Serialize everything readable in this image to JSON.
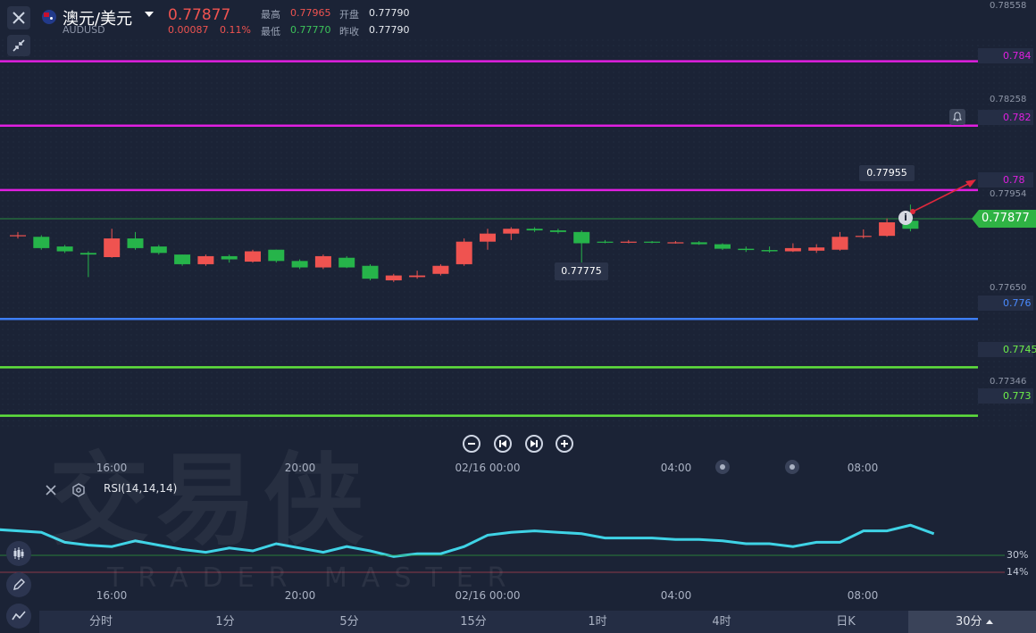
{
  "header": {
    "symbol_name": "澳元/美元",
    "symbol_code": "AUDUSD",
    "price": "0.77877",
    "change": "0.00087",
    "change_pct": "0.11%",
    "high_label": "最高",
    "high_value": "0.77965",
    "low_label": "最低",
    "low_value": "0.77770",
    "open_label": "开盘",
    "open_value": "0.77790",
    "prev_close_label": "昨收",
    "prev_close_value": "0.77790"
  },
  "price_axis": {
    "range": [
      0.7726,
      0.7859
    ],
    "faded_labels": [
      "0.78558",
      "0.78258",
      "0.77954",
      "0.77650",
      "0.77346"
    ],
    "current_price_tag": "0.77877"
  },
  "levels": [
    {
      "label": "0.784",
      "price": 0.784,
      "color": "#e01fe0"
    },
    {
      "label": "0.782",
      "price": 0.782,
      "color": "#e01fe0"
    },
    {
      "label": "0.78",
      "price": 0.78,
      "color": "#e01fe0"
    },
    {
      "label": "0.776",
      "price": 0.776,
      "color": "#3d7ef5"
    },
    {
      "label": "0.7745",
      "price": 0.7745,
      "color": "#5fe23c"
    },
    {
      "label": "0.773",
      "price": 0.773,
      "color": "#5fe23c"
    }
  ],
  "callouts": {
    "high_marker": "0.77955",
    "low_marker": "0.77775"
  },
  "time_axis": [
    "16:00",
    "20:00",
    "02/16 00:00",
    "04:00",
    "08:00"
  ],
  "indicator": {
    "name": "RSI(14,14,14)",
    "level_30": "30%",
    "level_14": "14%"
  },
  "watermark": {
    "main": "交易侠",
    "sub": "TRADER MASTER"
  },
  "timeframes": [
    "分时",
    "1分",
    "5分",
    "15分",
    "1时",
    "4时",
    "日K",
    "30分"
  ],
  "active_timeframe": "30分",
  "colors": {
    "up": "#ef5350",
    "down": "#26b44a",
    "current_price": "#2fb344",
    "rsi_line": "#3fd3e6"
  },
  "chart_data": {
    "type": "candlestick",
    "title": "AUDUSD 30分",
    "ylim": [
      0.7726,
      0.7859
    ],
    "candles": [
      {
        "o": 0.7786,
        "c": 0.7786,
        "h": 0.7787,
        "l": 0.7785
      },
      {
        "o": 0.77855,
        "c": 0.7782,
        "h": 0.7786,
        "l": 0.77815
      },
      {
        "o": 0.77825,
        "c": 0.7781,
        "h": 0.7783,
        "l": 0.77805
      },
      {
        "o": 0.77805,
        "c": 0.778,
        "h": 0.7781,
        "l": 0.7773
      },
      {
        "o": 0.77792,
        "c": 0.7785,
        "h": 0.7788,
        "l": 0.7779
      },
      {
        "o": 0.7785,
        "c": 0.7782,
        "h": 0.7787,
        "l": 0.77815
      },
      {
        "o": 0.77825,
        "c": 0.77805,
        "h": 0.7783,
        "l": 0.778
      },
      {
        "o": 0.778,
        "c": 0.7777,
        "h": 0.778,
        "l": 0.77765
      },
      {
        "o": 0.7777,
        "c": 0.77795,
        "h": 0.778,
        "l": 0.77765
      },
      {
        "o": 0.77795,
        "c": 0.77785,
        "h": 0.778,
        "l": 0.77775
      },
      {
        "o": 0.77778,
        "c": 0.7781,
        "h": 0.77815,
        "l": 0.77775
      },
      {
        "o": 0.77815,
        "c": 0.7778,
        "h": 0.77815,
        "l": 0.77775
      },
      {
        "o": 0.7778,
        "c": 0.7776,
        "h": 0.77785,
        "l": 0.77755
      },
      {
        "o": 0.7776,
        "c": 0.77795,
        "h": 0.778,
        "l": 0.77755
      },
      {
        "o": 0.7779,
        "c": 0.7776,
        "h": 0.77795,
        "l": 0.77758
      },
      {
        "o": 0.77765,
        "c": 0.77725,
        "h": 0.7777,
        "l": 0.7772
      },
      {
        "o": 0.7772,
        "c": 0.77735,
        "h": 0.7774,
        "l": 0.77715
      },
      {
        "o": 0.7773,
        "c": 0.77735,
        "h": 0.7775,
        "l": 0.77725
      },
      {
        "o": 0.7774,
        "c": 0.77765,
        "h": 0.7777,
        "l": 0.77735
      },
      {
        "o": 0.7777,
        "c": 0.7784,
        "h": 0.7785,
        "l": 0.77765
      },
      {
        "o": 0.7784,
        "c": 0.77865,
        "h": 0.7788,
        "l": 0.77815
      },
      {
        "o": 0.77865,
        "c": 0.7788,
        "h": 0.77885,
        "l": 0.77845
      },
      {
        "o": 0.7788,
        "c": 0.77875,
        "h": 0.77885,
        "l": 0.7787
      },
      {
        "o": 0.77875,
        "c": 0.7787,
        "h": 0.7788,
        "l": 0.77865
      },
      {
        "o": 0.7787,
        "c": 0.77835,
        "h": 0.77875,
        "l": 0.77775
      },
      {
        "o": 0.7784,
        "c": 0.77838,
        "h": 0.77845,
        "l": 0.77835
      },
      {
        "o": 0.77838,
        "c": 0.7784,
        "h": 0.77845,
        "l": 0.77835
      },
      {
        "o": 0.7784,
        "c": 0.77837,
        "h": 0.77842,
        "l": 0.77835
      },
      {
        "o": 0.77837,
        "c": 0.77838,
        "h": 0.77842,
        "l": 0.77834
      },
      {
        "o": 0.77838,
        "c": 0.77832,
        "h": 0.77842,
        "l": 0.7783
      },
      {
        "o": 0.77832,
        "c": 0.77818,
        "h": 0.77835,
        "l": 0.77814
      },
      {
        "o": 0.77818,
        "c": 0.77814,
        "h": 0.77825,
        "l": 0.77808
      },
      {
        "o": 0.77814,
        "c": 0.7781,
        "h": 0.77825,
        "l": 0.77806
      },
      {
        "o": 0.7781,
        "c": 0.7782,
        "h": 0.77835,
        "l": 0.77808
      },
      {
        "o": 0.77812,
        "c": 0.77822,
        "h": 0.77832,
        "l": 0.77805
      },
      {
        "o": 0.77815,
        "c": 0.77855,
        "h": 0.7787,
        "l": 0.77812
      },
      {
        "o": 0.77855,
        "c": 0.77858,
        "h": 0.77878,
        "l": 0.7785
      },
      {
        "o": 0.77858,
        "c": 0.779,
        "h": 0.77912,
        "l": 0.77855
      },
      {
        "o": 0.77905,
        "c": 0.7788,
        "h": 0.77955,
        "l": 0.77872
      }
    ],
    "rsi": [
      45,
      43,
      36,
      34,
      33,
      37,
      34,
      31,
      29,
      32,
      30,
      35,
      32,
      29,
      33,
      30,
      26,
      28,
      28,
      33,
      41,
      43,
      44,
      43,
      42,
      39,
      39,
      39,
      38,
      38,
      37,
      35,
      35,
      33,
      36,
      36,
      44,
      44,
      48,
      42
    ],
    "rsi_ylim": [
      0,
      75
    ]
  }
}
